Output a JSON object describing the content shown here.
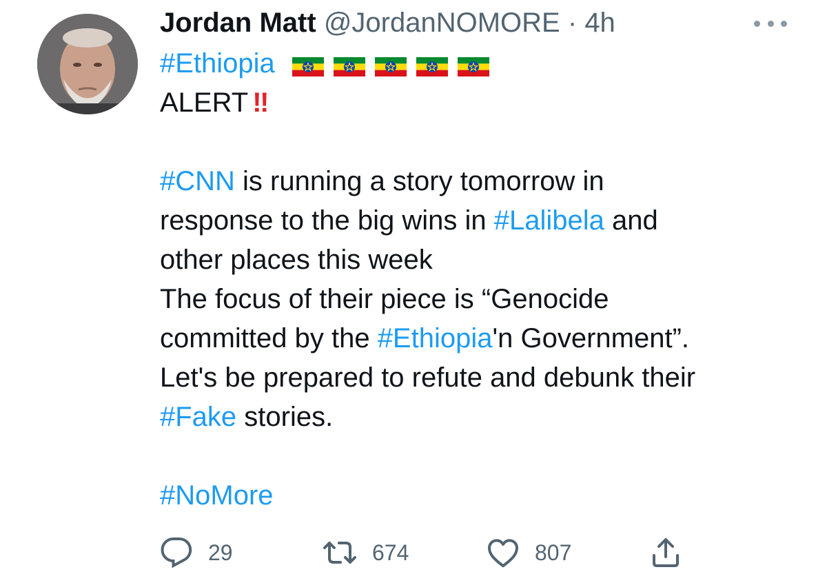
{
  "author": {
    "name": "Jordan Matt",
    "handle": "@JordanNOMORE",
    "separator": "·",
    "time": "4h"
  },
  "tweet": {
    "line1_hashtag": "#Ethiopia",
    "flag_count_visible": 5,
    "alert_text": "ALERT",
    "alert_emoji": "‼",
    "line2_hashtag": "#CNN",
    "line2_text": " is running a story tomorrow in",
    "line3_text_a": "response to the big wins in ",
    "line3_hashtag": "#Lalibela",
    "line3_text_b": " and",
    "line4_text": "other places this week",
    "line5_text": "The focus of their piece is “Genocide",
    "line6_text_a": "committed by the ",
    "line6_hashtag": "#Ethiopia",
    "line6_text_b": "'n Government”.",
    "line7_text": "Let's be prepared to refute and debunk their",
    "line8_hashtag": "#Fake",
    "line8_text": " stories.",
    "line9_hashtag": "#NoMore"
  },
  "actions": {
    "reply_count": "29",
    "retweet_count": "674",
    "like_count": "807",
    "share_count": ""
  },
  "colors": {
    "link": "#1d9bf0",
    "secondary_text": "#536471",
    "alert_red": "#e0242b",
    "icon_gray": "#536471"
  },
  "icons": {
    "reply": "reply-bubble-icon",
    "retweet": "retweet-arrows-icon",
    "like": "heart-icon",
    "share": "share-upload-icon",
    "more": "more-dots-icon",
    "flag": "ethiopia-flag-emoji"
  }
}
